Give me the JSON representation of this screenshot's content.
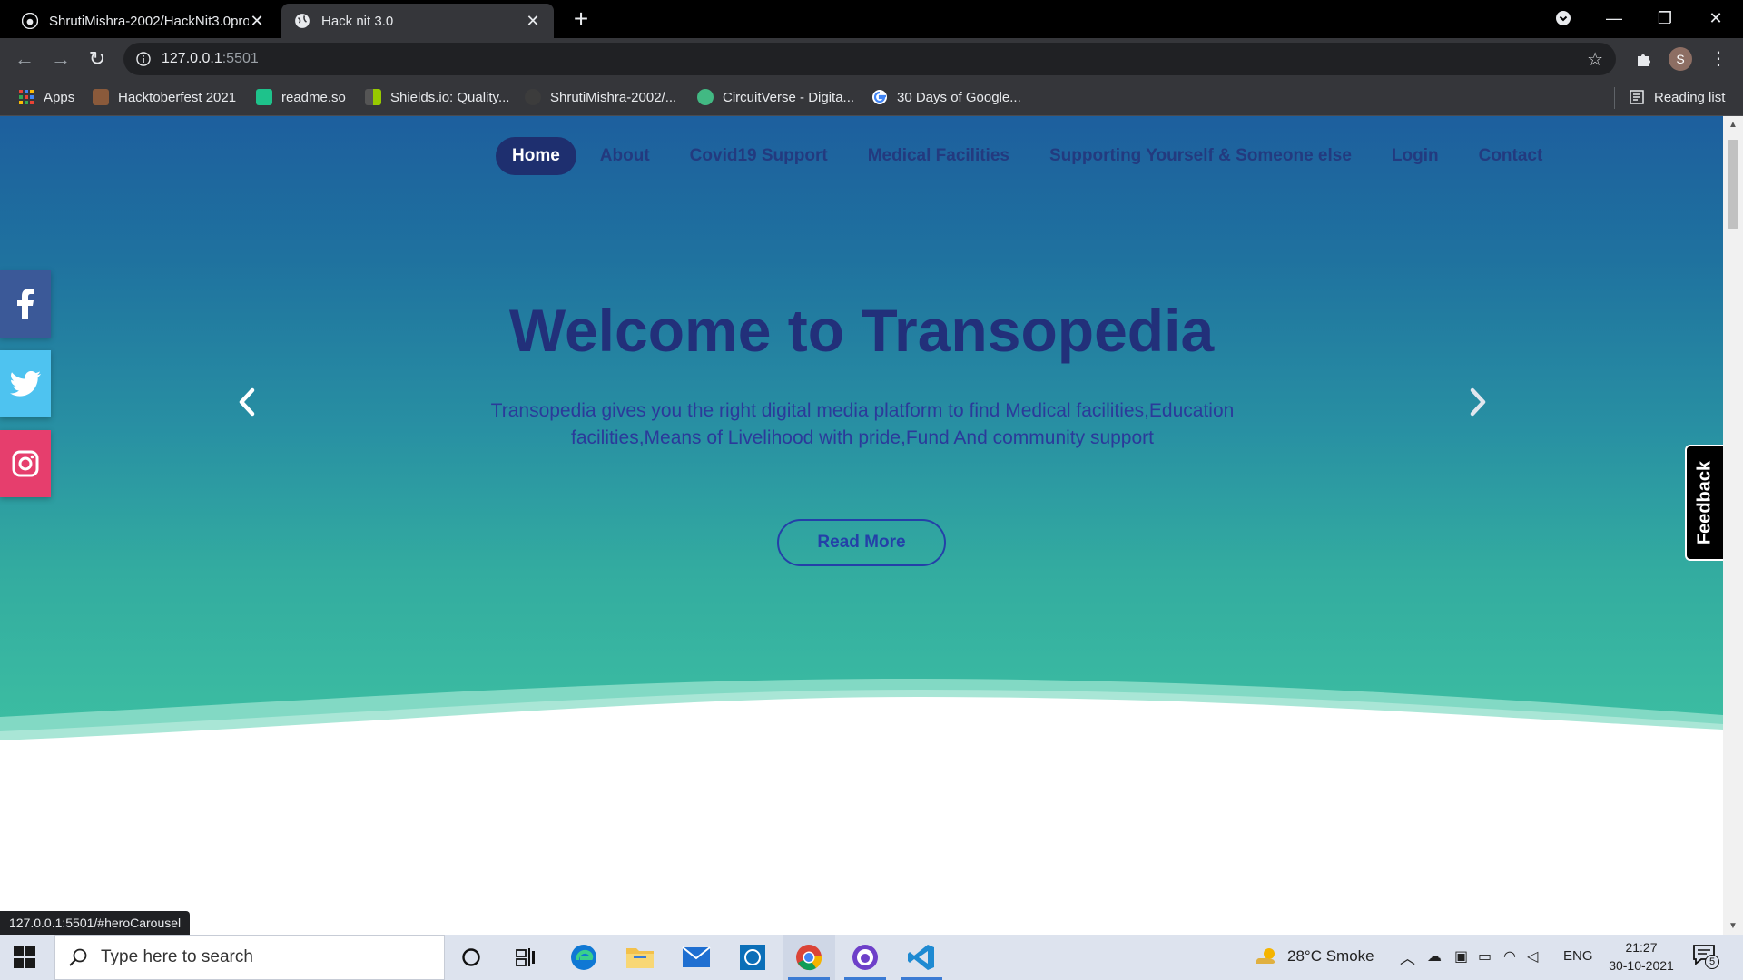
{
  "browser": {
    "tabs": [
      {
        "title": "ShrutiMishra-2002/HackNit3.0pro",
        "active": false
      },
      {
        "title": "Hack nit 3.0",
        "active": true
      }
    ],
    "url_host": "127.0.0.1",
    "url_port": ":5501",
    "profile_initial": "S",
    "bookmarks": [
      {
        "label": "Apps",
        "icon": "apps-grid-icon"
      },
      {
        "label": "Hacktoberfest 2021",
        "icon": "hacktoberfest-icon"
      },
      {
        "label": "readme.so",
        "icon": "readme-icon"
      },
      {
        "label": "Shields.io: Quality...",
        "icon": "shields-icon"
      },
      {
        "label": "ShrutiMishra-2002/...",
        "icon": "github-icon"
      },
      {
        "label": "CircuitVerse - Digita...",
        "icon": "circuitverse-icon"
      },
      {
        "label": "30 Days of Google...",
        "icon": "google-icon"
      }
    ],
    "reading_list_label": "Reading list",
    "status_url": "127.0.0.1:5501/#heroCarousel"
  },
  "site": {
    "nav": [
      {
        "label": "Home",
        "active": true
      },
      {
        "label": "About",
        "active": false
      },
      {
        "label": "Covid19 Support",
        "active": false
      },
      {
        "label": "Medical Facilities",
        "active": false
      },
      {
        "label": "Supporting Yourself & Someone else",
        "active": false
      },
      {
        "label": "Login",
        "active": false
      },
      {
        "label": "Contact",
        "active": false
      }
    ],
    "hero": {
      "title": "Welcome to Transopedia",
      "description": "Transopedia gives you the right digital media platform to find Medical facilities,Education facilities,Means of Livelihood with pride,Fund And community support",
      "cta_label": "Read More"
    },
    "social": [
      {
        "name": "facebook",
        "color": "#3b5998"
      },
      {
        "name": "twitter",
        "color": "#4ec3f0"
      },
      {
        "name": "instagram",
        "color": "#e63e6d"
      }
    ],
    "feedback_label": "Feedback"
  },
  "taskbar": {
    "search_placeholder": "Type here to search",
    "weather": "28°C  Smoke",
    "language": "ENG",
    "time": "21:27",
    "date": "30-10-2021",
    "notification_count": "5"
  },
  "colors": {
    "hero_top": "#1d5f9e",
    "hero_bottom": "#3ec2a2",
    "nav_active_bg": "#1e2f6f",
    "title": "#22307a",
    "accent": "#2440a8"
  }
}
